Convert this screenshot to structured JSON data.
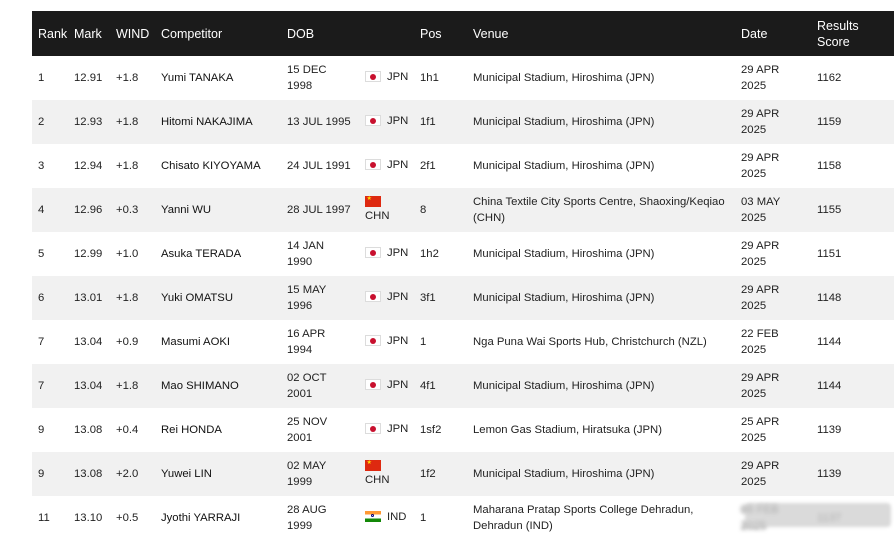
{
  "table": {
    "headers": {
      "rank": "Rank",
      "mark": "Mark",
      "wind": "WIND",
      "competitor": "Competitor",
      "dob": "DOB",
      "nat": "",
      "pos": "Pos",
      "venue": "Venue",
      "date": "Date",
      "score_line1": "Results",
      "score_line2": "Score"
    },
    "rows": [
      {
        "rank": "1",
        "mark": "12.91",
        "wind": "+1.8",
        "competitor": "Yumi TANAKA",
        "dob_l1": "15 DEC",
        "dob_l2": "1998",
        "flag": "JPN",
        "nat": "JPN",
        "pos": "1h1",
        "venue": "Municipal Stadium, Hiroshima (JPN)",
        "date_l1": "29 APR",
        "date_l2": "2025",
        "score": "1162"
      },
      {
        "rank": "2",
        "mark": "12.93",
        "wind": "+1.8",
        "competitor": "Hitomi NAKAJIMA",
        "dob_l1": "13 JUL 1995",
        "dob_l2": "",
        "flag": "JPN",
        "nat": "JPN",
        "pos": "1f1",
        "venue": "Municipal Stadium, Hiroshima (JPN)",
        "date_l1": "29 APR",
        "date_l2": "2025",
        "score": "1159"
      },
      {
        "rank": "3",
        "mark": "12.94",
        "wind": "+1.8",
        "competitor": "Chisato KIYOYAMA",
        "dob_l1": "24 JUL 1991",
        "dob_l2": "",
        "flag": "JPN",
        "nat": "JPN",
        "pos": "2f1",
        "venue": "Municipal Stadium, Hiroshima (JPN)",
        "date_l1": "29 APR",
        "date_l2": "2025",
        "score": "1158"
      },
      {
        "rank": "4",
        "mark": "12.96",
        "wind": "+0.3",
        "competitor": "Yanni WU",
        "dob_l1": "28 JUL 1997",
        "dob_l2": "",
        "flag": "CHN",
        "nat": "CHN",
        "pos": "8",
        "venue": "China Textile City Sports Centre, Shaoxing/Keqiao (CHN)",
        "date_l1": "03 MAY",
        "date_l2": "2025",
        "score": "1155"
      },
      {
        "rank": "5",
        "mark": "12.99",
        "wind": "+1.0",
        "competitor": "Asuka TERADA",
        "dob_l1": "14 JAN",
        "dob_l2": "1990",
        "flag": "JPN",
        "nat": "JPN",
        "pos": "1h2",
        "venue": "Municipal Stadium, Hiroshima (JPN)",
        "date_l1": "29 APR",
        "date_l2": "2025",
        "score": "1151"
      },
      {
        "rank": "6",
        "mark": "13.01",
        "wind": "+1.8",
        "competitor": "Yuki OMATSU",
        "dob_l1": "15 MAY",
        "dob_l2": "1996",
        "flag": "JPN",
        "nat": "JPN",
        "pos": "3f1",
        "venue": "Municipal Stadium, Hiroshima (JPN)",
        "date_l1": "29 APR",
        "date_l2": "2025",
        "score": "1148"
      },
      {
        "rank": "7",
        "mark": "13.04",
        "wind": "+0.9",
        "competitor": "Masumi AOKI",
        "dob_l1": "16 APR",
        "dob_l2": "1994",
        "flag": "JPN",
        "nat": "JPN",
        "pos": "1",
        "venue": "Nga Puna Wai Sports Hub, Christchurch (NZL)",
        "date_l1": "22 FEB",
        "date_l2": "2025",
        "score": "1144"
      },
      {
        "rank": "7",
        "mark": "13.04",
        "wind": "+1.8",
        "competitor": "Mao SHIMANO",
        "dob_l1": "02 OCT",
        "dob_l2": "2001",
        "flag": "JPN",
        "nat": "JPN",
        "pos": "4f1",
        "venue": "Municipal Stadium, Hiroshima (JPN)",
        "date_l1": "29 APR",
        "date_l2": "2025",
        "score": "1144"
      },
      {
        "rank": "9",
        "mark": "13.08",
        "wind": "+0.4",
        "competitor": "Rei HONDA",
        "dob_l1": "25 NOV",
        "dob_l2": "2001",
        "flag": "JPN",
        "nat": "JPN",
        "pos": "1sf2",
        "venue": "Lemon Gas Stadium, Hiratsuka (JPN)",
        "date_l1": "25 APR",
        "date_l2": "2025",
        "score": "1139"
      },
      {
        "rank": "9",
        "mark": "13.08",
        "wind": "+2.0",
        "competitor": "Yuwei LIN",
        "dob_l1": "02 MAY",
        "dob_l2": "1999",
        "flag": "CHN",
        "nat": "CHN",
        "pos": "1f2",
        "venue": "Municipal Stadium, Hiroshima (JPN)",
        "date_l1": "29 APR",
        "date_l2": "2025",
        "score": "1139"
      },
      {
        "rank": "11",
        "mark": "13.10",
        "wind": "+0.5",
        "competitor": "Jyothi YARRAJI",
        "dob_l1": "28 AUG",
        "dob_l2": "1999",
        "flag": "IND",
        "nat": "IND",
        "pos": "1",
        "venue": "Maharana Pratap Sports College Dehradun, Dehradun (IND)",
        "date_l1": "06 FEB",
        "date_l2": "2025",
        "score": "1137",
        "obscured": true
      }
    ]
  },
  "colors": {
    "header_bg": "#1b1b1b",
    "header_text": "#ffffff",
    "row_alt": "#f1f1f1"
  }
}
